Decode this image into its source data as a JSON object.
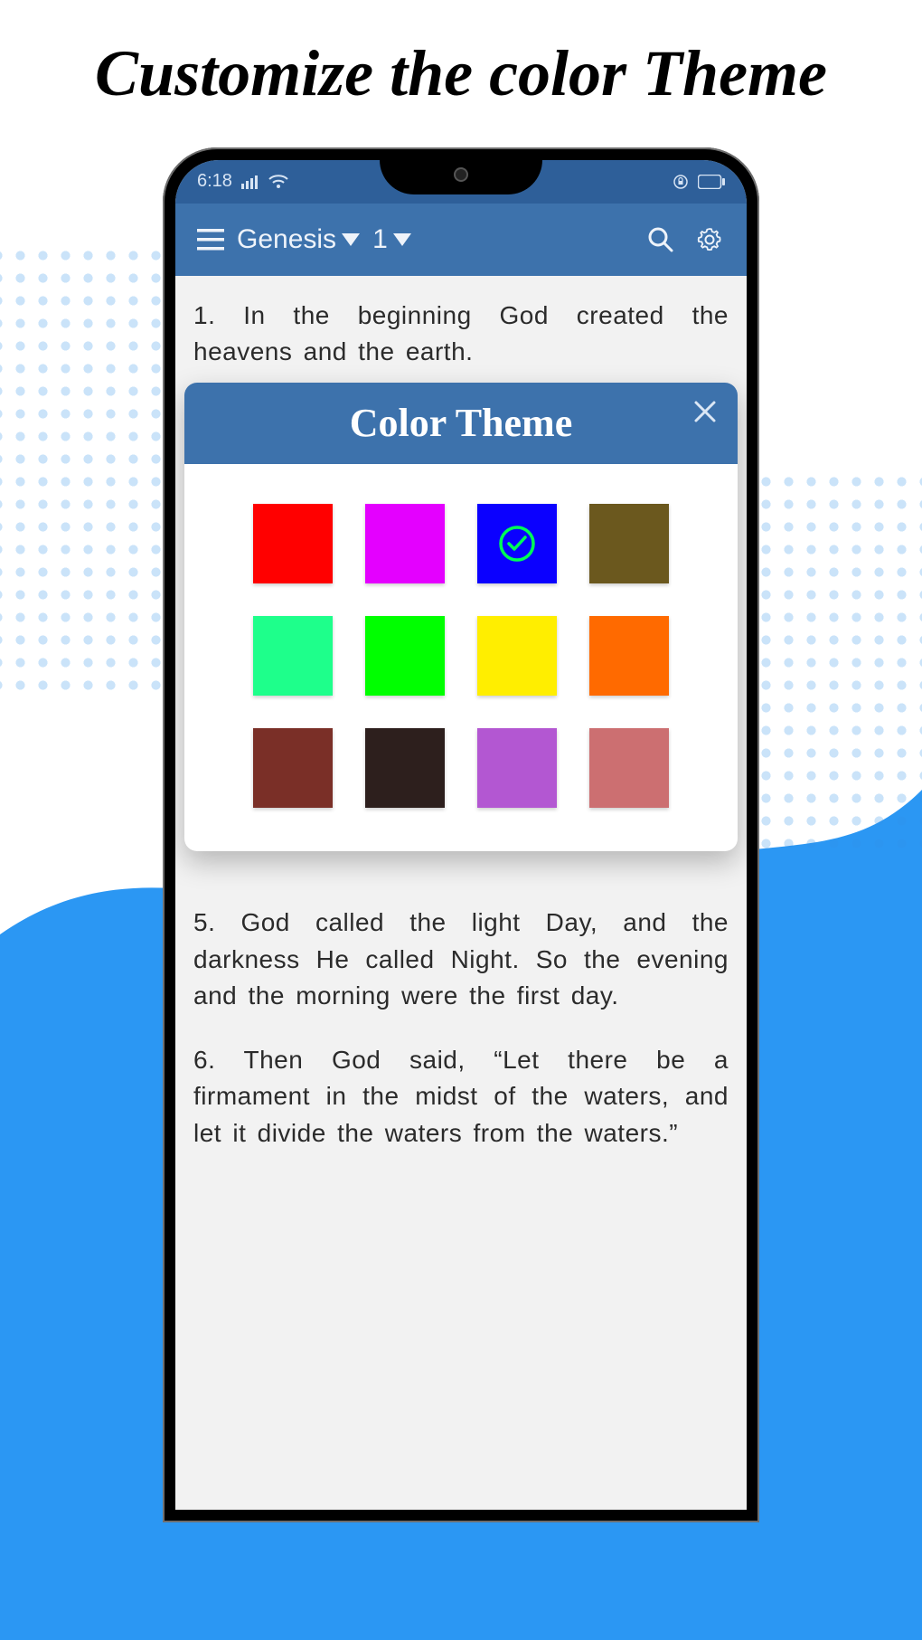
{
  "page": {
    "title": "Customize the color Theme"
  },
  "status": {
    "time": "6:18"
  },
  "appbar": {
    "book": "Genesis",
    "chapter": "1"
  },
  "verses": {
    "v1": "1. In the beginning God created the heavens and the earth.",
    "v5": "5. God called the light Day, and the darkness He called Night. So the evening and the morning were the first day.",
    "v6": "6. Then God said, “Let there be a firmament in the midst of the waters, and let it divide the waters from the waters.”"
  },
  "dialog": {
    "title": "Color Theme"
  },
  "colors": [
    {
      "name": "red",
      "hex": "#ff0000",
      "selected": false
    },
    {
      "name": "magenta",
      "hex": "#e400ff",
      "selected": false
    },
    {
      "name": "blue",
      "hex": "#0b00ff",
      "selected": true
    },
    {
      "name": "olive",
      "hex": "#6b581e",
      "selected": false
    },
    {
      "name": "mint",
      "hex": "#1eff8b",
      "selected": false
    },
    {
      "name": "green",
      "hex": "#00ff00",
      "selected": false
    },
    {
      "name": "yellow",
      "hex": "#ffee00",
      "selected": false
    },
    {
      "name": "orange",
      "hex": "#ff6a00",
      "selected": false
    },
    {
      "name": "brown",
      "hex": "#7a2f27",
      "selected": false
    },
    {
      "name": "dark-brown",
      "hex": "#2d1f1d",
      "selected": false
    },
    {
      "name": "purple",
      "hex": "#b357d2",
      "selected": false
    },
    {
      "name": "rose",
      "hex": "#cc6f71",
      "selected": false
    }
  ]
}
